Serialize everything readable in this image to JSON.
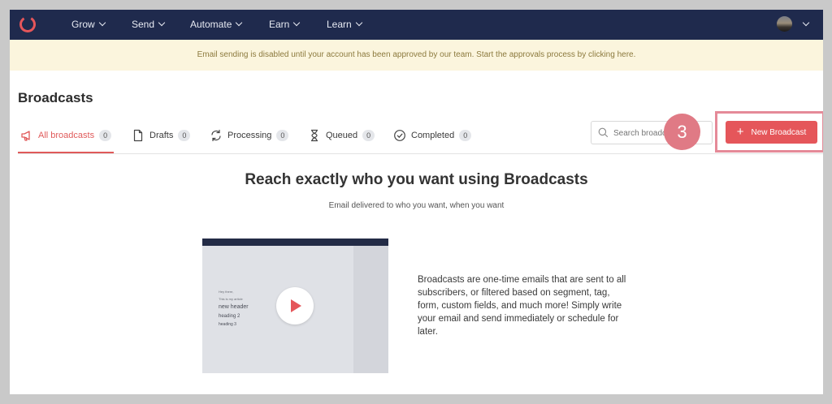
{
  "nav": {
    "items": [
      {
        "label": "Grow"
      },
      {
        "label": "Send"
      },
      {
        "label": "Automate"
      },
      {
        "label": "Earn"
      },
      {
        "label": "Learn"
      }
    ]
  },
  "banner": {
    "text": "Email sending is disabled until your account has been approved by our team. Start the approvals process by clicking here."
  },
  "page": {
    "title": "Broadcasts"
  },
  "tabs": [
    {
      "label": "All broadcasts",
      "count": "0",
      "icon": "megaphone-icon"
    },
    {
      "label": "Drafts",
      "count": "0",
      "icon": "document-icon"
    },
    {
      "label": "Processing",
      "count": "0",
      "icon": "refresh-icon"
    },
    {
      "label": "Queued",
      "count": "0",
      "icon": "hourglass-icon"
    },
    {
      "label": "Completed",
      "count": "0",
      "icon": "check-circle-icon"
    }
  ],
  "search": {
    "placeholder": "Search broadcasts"
  },
  "step_marker": "3",
  "new_button": {
    "label": "New Broadcast"
  },
  "empty_state": {
    "heading": "Reach exactly who you want using Broadcasts",
    "subheading": "Email delivered to who you want, when you want",
    "description": "Broadcasts are one-time emails that are sent to all subscribers, or filtered based on segment, tag, form, custom fields, and much more! Simply write your email and send immediately or schedule for later.",
    "video_lines": [
      "Hey there,",
      "This is my article",
      "new header",
      "heading 2",
      "heading 3"
    ]
  },
  "colors": {
    "nav": "#1f2a4d",
    "accent": "#e5565a",
    "banner_bg": "#fbf5dd",
    "step": "#e07a85"
  }
}
